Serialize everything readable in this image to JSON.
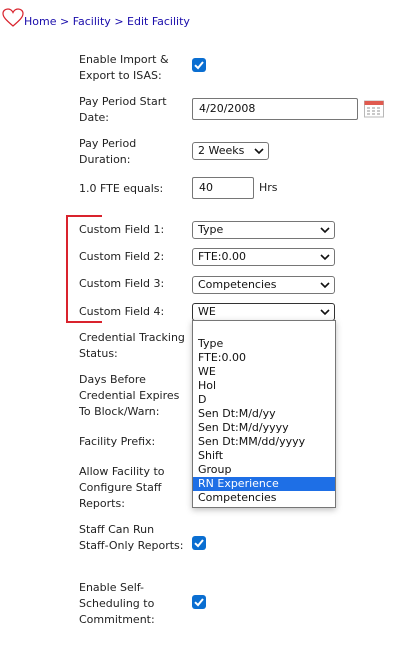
{
  "breadcrumb": {
    "home": "Home",
    "sep": ">",
    "facility": "Facility",
    "current": "Edit Facility"
  },
  "form": {
    "enable_import_label": "Enable Import & Export to ISAS:",
    "enable_import_checked": true,
    "pay_period_start_label": "Pay Period Start Date:",
    "pay_period_start_value": "4/20/2008",
    "pay_period_duration_label": "Pay Period Duration:",
    "pay_period_duration_value": "2 Weeks",
    "fte_label": "1.0 FTE equals:",
    "fte_value": "40",
    "fte_unit": "Hrs",
    "custom_field_1_label": "Custom Field 1:",
    "custom_field_1_value": "Type",
    "custom_field_2_label": "Custom Field 2:",
    "custom_field_2_value": "FTE:0.00",
    "custom_field_3_label": "Custom Field 3:",
    "custom_field_3_value": "Competencies",
    "custom_field_4_label": "Custom Field 4:",
    "custom_field_4_value": "WE",
    "credential_tracking_label": "Credential Tracking Status:",
    "days_before_label": "Days Before Credential Expires To Block/Warn:",
    "facility_prefix_label": "Facility Prefix:",
    "allow_configure_label": "Allow Facility to Configure Staff Reports:",
    "staff_only_label": "Staff Can Run Staff-Only Reports:",
    "staff_only_checked": true,
    "self_scheduling_label": "Enable Self-Scheduling to Commitment:",
    "self_scheduling_checked": true
  },
  "dropdown": {
    "options": [
      "",
      "Type",
      "FTE:0.00",
      "WE",
      "Hol",
      "D",
      "Sen Dt:M/d/yy",
      "Sen Dt:M/d/yyyy",
      "Sen Dt:MM/dd/yyyy",
      "Shift",
      "Group",
      "RN Experience",
      "Competencies"
    ],
    "highlighted": "RN Experience"
  },
  "colors": {
    "link": "#1a0dab",
    "checkbox": "#0a6ed1",
    "highlight": "#1e6fe6",
    "annotation": "#d9232d"
  }
}
